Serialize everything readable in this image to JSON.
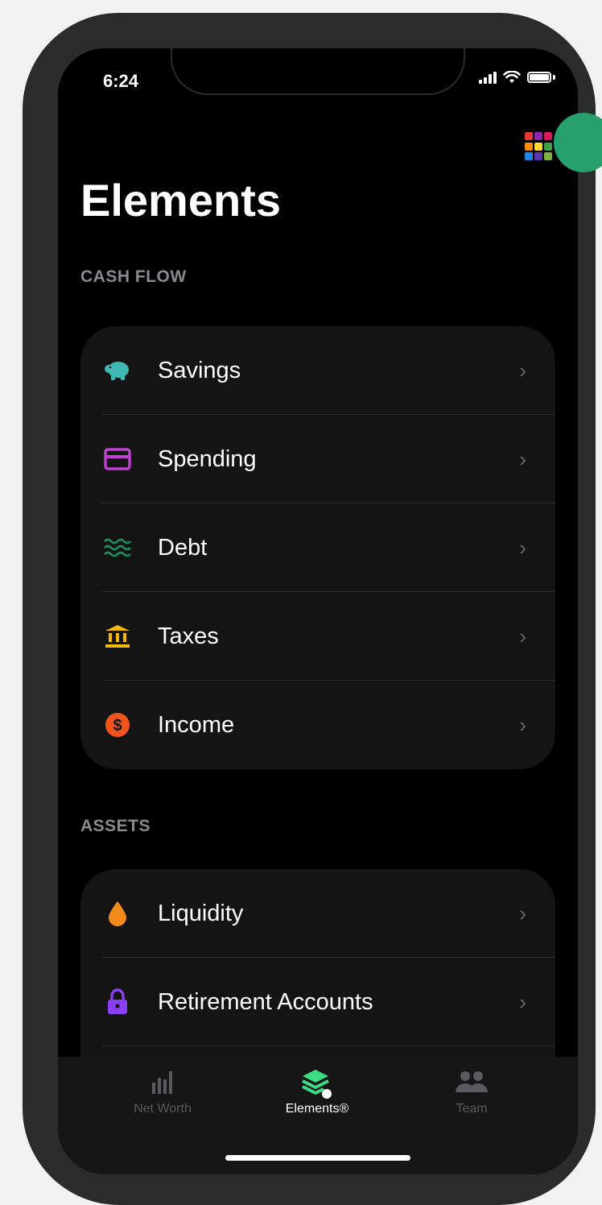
{
  "status_bar": {
    "time": "6:24"
  },
  "header": {
    "title": "Elements"
  },
  "sections": [
    {
      "label": "CASH FLOW",
      "items": [
        {
          "label": "Savings",
          "icon": "piggy-bank-icon",
          "color": "#3fb8b2"
        },
        {
          "label": "Spending",
          "icon": "credit-card-icon",
          "color": "#c23fd6"
        },
        {
          "label": "Debt",
          "icon": "waves-icon",
          "color": "#1e8f5a"
        },
        {
          "label": "Taxes",
          "icon": "bank-building-icon",
          "color": "#f2b90c"
        },
        {
          "label": "Income",
          "icon": "dollar-coin-icon",
          "color": "#f2551b"
        }
      ]
    },
    {
      "label": "ASSETS",
      "items": [
        {
          "label": "Liquidity",
          "icon": "water-drop-icon",
          "color": "#f28b1c"
        },
        {
          "label": "Retirement Accounts",
          "icon": "lock-icon",
          "color": "#8b3ff2"
        }
      ]
    }
  ],
  "tabbar": {
    "tabs": [
      {
        "label": "Net Worth",
        "icon": "bar-chart-icon",
        "active": false
      },
      {
        "label": "Elements®",
        "icon": "layers-icon",
        "active": true
      },
      {
        "label": "Team",
        "icon": "people-icon",
        "active": false
      }
    ]
  },
  "colors": {
    "accent_green": "#27a06e",
    "background": "#000000",
    "card": "#141414",
    "muted_text": "#8a8a8e"
  }
}
